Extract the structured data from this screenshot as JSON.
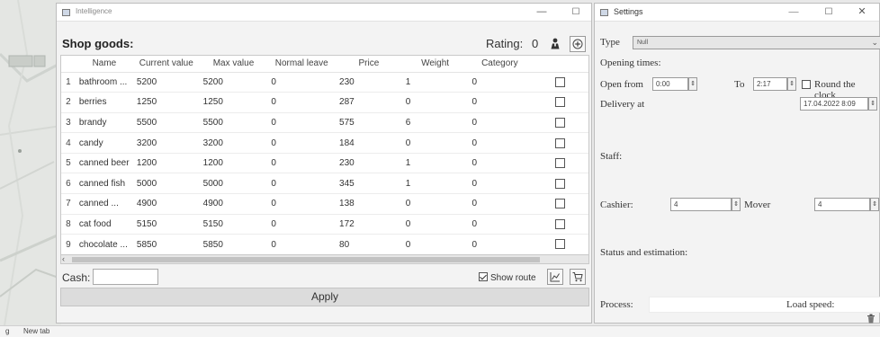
{
  "main_window": {
    "title": "Intelligence",
    "controls": {
      "minimize": "—",
      "maximize": "☐"
    }
  },
  "shop": {
    "header": "Shop goods:",
    "rating_label": "Rating:",
    "rating_value": "0",
    "icons": {
      "person": "person-icon",
      "add": "plus-circle-icon"
    }
  },
  "table": {
    "columns": [
      "Name",
      "Current value",
      "Max value",
      "Normal leave",
      "Price",
      "Weight",
      "Category"
    ],
    "rows": [
      {
        "idx": "1",
        "name": "bathroom ...",
        "current": "5200",
        "max": "5200",
        "leave": "0",
        "price": "230",
        "weight": "1",
        "category": "0"
      },
      {
        "idx": "2",
        "name": "berries",
        "current": "1250",
        "max": "1250",
        "leave": "0",
        "price": "287",
        "weight": "0",
        "category": "0"
      },
      {
        "idx": "3",
        "name": "brandy",
        "current": "5500",
        "max": "5500",
        "leave": "0",
        "price": "575",
        "weight": "6",
        "category": "0"
      },
      {
        "idx": "4",
        "name": "candy",
        "current": "3200",
        "max": "3200",
        "leave": "0",
        "price": "184",
        "weight": "0",
        "category": "0"
      },
      {
        "idx": "5",
        "name": "canned beer",
        "current": "1200",
        "max": "1200",
        "leave": "0",
        "price": "230",
        "weight": "1",
        "category": "0"
      },
      {
        "idx": "6",
        "name": "canned fish",
        "current": "5000",
        "max": "5000",
        "leave": "0",
        "price": "345",
        "weight": "1",
        "category": "0"
      },
      {
        "idx": "7",
        "name": "canned ...",
        "current": "4900",
        "max": "4900",
        "leave": "0",
        "price": "138",
        "weight": "0",
        "category": "0"
      },
      {
        "idx": "8",
        "name": "cat food",
        "current": "5150",
        "max": "5150",
        "leave": "0",
        "price": "172",
        "weight": "0",
        "category": "0"
      },
      {
        "idx": "9",
        "name": "chocolate ...",
        "current": "5850",
        "max": "5850",
        "leave": "0",
        "price": "80",
        "weight": "0",
        "category": "0"
      }
    ],
    "scroll_arrow": "‹"
  },
  "bottom_bar": {
    "cash_label": "Cash:",
    "cash_value": "",
    "show_route_label": "Show route",
    "show_route_checked": true,
    "icons": {
      "chart": "line-chart-icon",
      "cart": "cart-icon"
    },
    "apply_label": "Apply"
  },
  "settings": {
    "title": "Settings",
    "controls": {
      "minimize": "—",
      "maximize": "☐",
      "close": "✕"
    },
    "type_label": "Type",
    "type_value": "Null",
    "opening_times_label": "Opening times:",
    "open_from_label": "Open from",
    "open_from_value": "0:00",
    "to_label": "To",
    "to_value": "2:17",
    "round_clock_label": "Round the clock",
    "delivery_label": "Delivery at",
    "delivery_value": "17.04.2022 8:09",
    "staff_label": "Staff:",
    "cashier_label": "Cashier:",
    "cashier_value": "4",
    "mover_label": "Mover",
    "mover_value": "4",
    "status_label": "Status and estimation:",
    "process_label": "Process:",
    "load_speed_label": "Load speed:",
    "icons": {
      "trash": "trash-icon"
    }
  },
  "taskbar": {
    "letter": "g",
    "new_tab": "New tab"
  }
}
